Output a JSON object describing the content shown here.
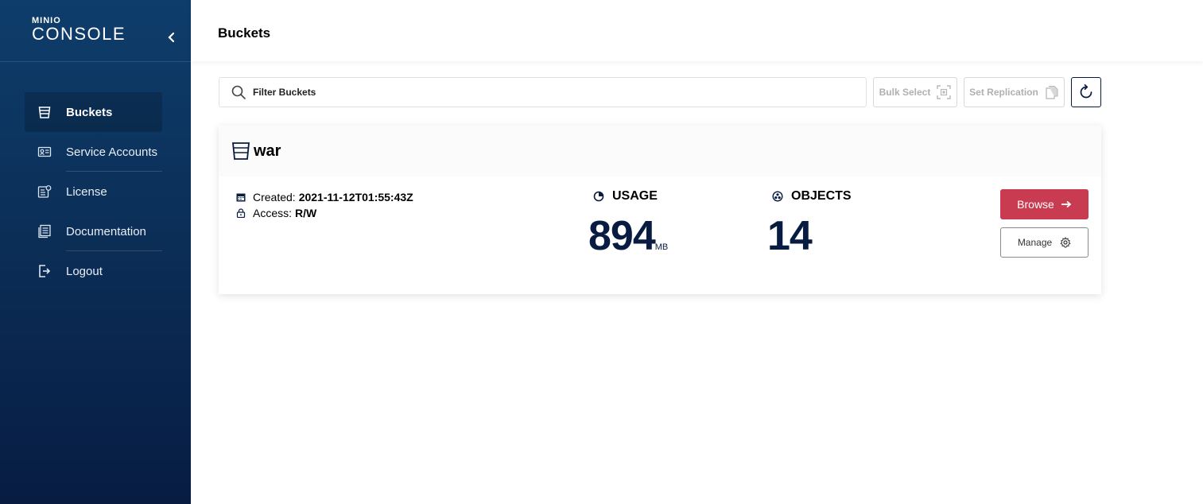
{
  "brand": {
    "top": "MINIO",
    "bottom": "CONSOLE"
  },
  "sidebar": {
    "items": [
      {
        "label": "Buckets",
        "icon": "bucket-icon",
        "active": true
      },
      {
        "label": "Service Accounts",
        "icon": "service-account-icon",
        "active": false
      },
      {
        "label": "License",
        "icon": "license-icon",
        "active": false
      },
      {
        "label": "Documentation",
        "icon": "documentation-icon",
        "active": false
      },
      {
        "label": "Logout",
        "icon": "logout-icon",
        "active": false
      }
    ]
  },
  "header": {
    "title": "Buckets"
  },
  "toolbar": {
    "filter_placeholder": "Filter Buckets",
    "bulk_select_label": "Bulk Select",
    "set_replication_label": "Set Replication"
  },
  "bucket": {
    "name": "war",
    "created_label": "Created:",
    "created_value": "2021-11-12T01:55:43Z",
    "access_label": "Access:",
    "access_value": "R/W",
    "usage_label": "USAGE",
    "usage_value": "894",
    "usage_unit": "MB",
    "objects_label": "OBJECTS",
    "objects_value": "14",
    "browse_label": "Browse",
    "manage_label": "Manage"
  },
  "colors": {
    "sidebar_top": "#0e3d6b",
    "sidebar_bottom": "#081c42",
    "accent": "#c83b51",
    "value_text": "#081c42"
  }
}
